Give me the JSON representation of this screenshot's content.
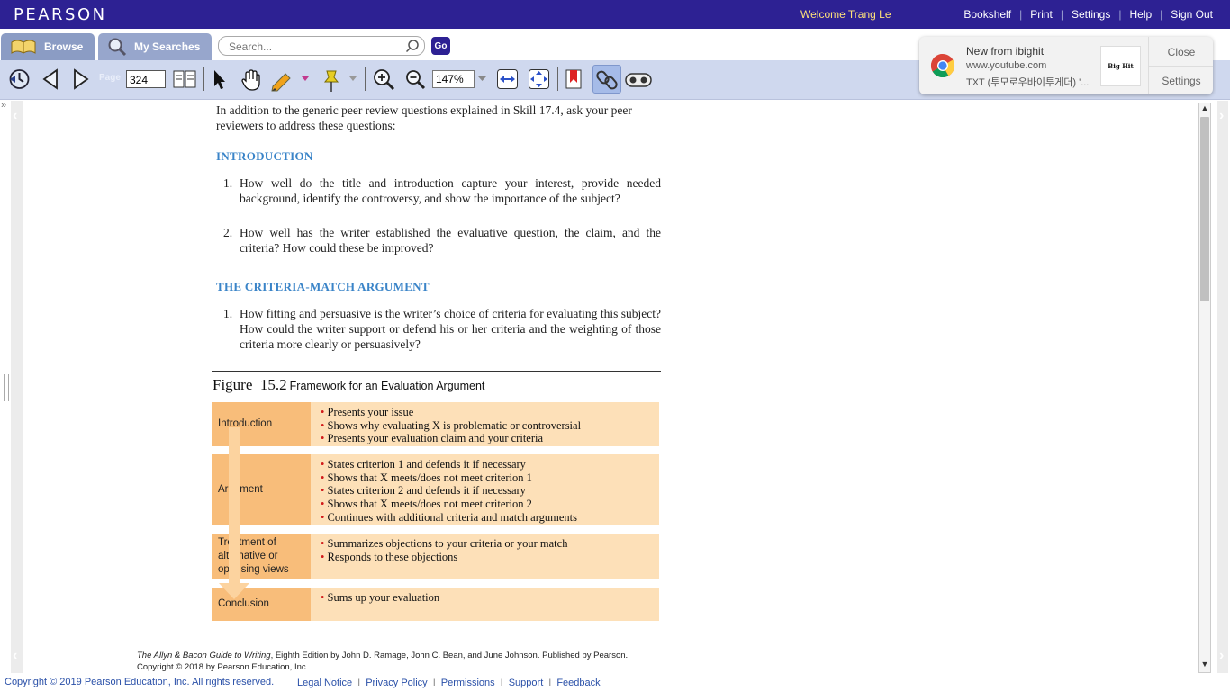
{
  "header": {
    "logo": "PEARSON",
    "welcome": "Welcome Trang Le",
    "links": [
      "Bookshelf",
      "Print",
      "Settings",
      "Help",
      "Sign Out"
    ]
  },
  "tabs": {
    "browse": "Browse",
    "my_searches": "My Searches"
  },
  "search": {
    "placeholder": "Search...",
    "go": "Go"
  },
  "toolbar": {
    "page_label": "Page",
    "page_value": "324",
    "zoom_value": "147%"
  },
  "notification": {
    "title": "New from ibighit",
    "url": "www.youtube.com",
    "message": "TXT (투모로우바이투게더) '...",
    "thumb_text": "Big Hit",
    "close": "Close",
    "settings": "Settings"
  },
  "content": {
    "intro": "In addition to the generic peer review questions explained in Skill 17.4, ask your peer reviewers to address these questions:",
    "section1": "INTRODUCTION",
    "s1_items": [
      "How well do the title and introduction capture your interest, provide needed background, identify the controversy, and show the importance of the subject?",
      "How well has the writer established the evaluative question, the claim, and the criteria? How could these be improved?"
    ],
    "section2": "THE CRITERIA-MATCH ARGUMENT",
    "s2_items": [
      "How fitting and persuasive is the writer’s choice of criteria for evaluating this subject? How could the writer support or defend his or her criteria and the weighting of those criteria more clearly or persuasively?"
    ]
  },
  "figure": {
    "label": "Figure",
    "number": "15.2",
    "caption": "Framework for an Evaluation Argument",
    "rows": [
      {
        "label": "Introduction",
        "bullets": [
          "Presents your issue",
          "Shows why evaluating X is problematic or controversial",
          "Presents your evaluation claim and your criteria"
        ]
      },
      {
        "label": "Argument",
        "bullets": [
          "States criterion 1 and defends it if necessary",
          "Shows that X meets/does not meet criterion 1",
          "States criterion 2 and defends it if necessary",
          "Shows that X meets/does not meet criterion 2",
          "Continues with additional criteria and match arguments"
        ]
      },
      {
        "label": "Treatment of alternative or opposing views",
        "bullets": [
          "Summarizes objections to your criteria or your match",
          "Responds to these objections"
        ]
      },
      {
        "label": "Conclusion",
        "bullets": [
          "Sums up your evaluation"
        ]
      }
    ]
  },
  "citation": {
    "book": "The Allyn & Bacon Guide to Writing",
    "rest": ", Eighth Edition by John D. Ramage, John C. Bean, and June Johnson. Published by Pearson.",
    "line2": "Copyright © 2018 by Pearson Education, Inc."
  },
  "footer": {
    "copyright": "Copyright © 2019 Pearson Education, Inc. All rights reserved.",
    "links": [
      "Legal Notice",
      "Privacy Policy",
      "Permissions",
      "Support",
      "Feedback"
    ]
  },
  "colors": {
    "brand": "#2d2193",
    "heading": "#3a84c8",
    "figure_label": "#f8bd7a",
    "figure_body": "#fde0b8",
    "bullet": "#d21b1b"
  }
}
